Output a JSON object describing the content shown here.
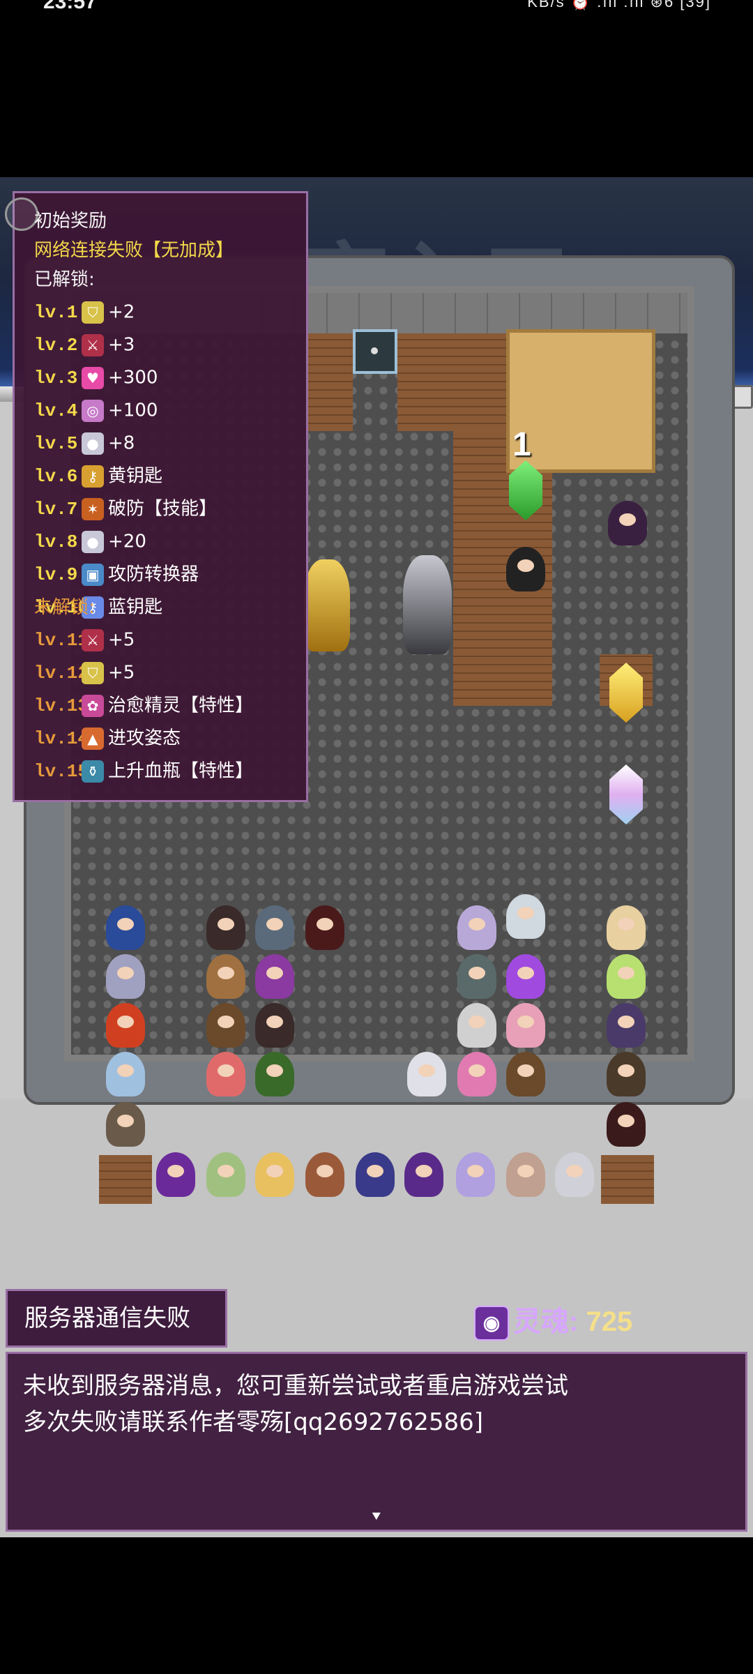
{
  "status_bar": {
    "time": "23:57",
    "right": "KB/s ⏰ .ıll .ıll ⊛6 [39]"
  },
  "banner": {
    "ghost_text": "牢入口"
  },
  "board": {
    "room_number": "1"
  },
  "info_panel": {
    "title": "初始奖励",
    "network_status": "网络连接失败【无加成】",
    "unlocked_header": "已解锁:",
    "locked_header": "未解锁:",
    "unlocked": [
      {
        "level": "lv.1",
        "icon": "shield-icon",
        "color": "#d8c24a",
        "reward": "+2"
      },
      {
        "level": "lv.2",
        "icon": "sword-icon",
        "color": "#b0304a",
        "reward": "+3"
      },
      {
        "level": "lv.3",
        "icon": "heart-icon",
        "color": "#e84aa8",
        "reward": "+300"
      },
      {
        "level": "lv.4",
        "icon": "magic-icon",
        "color": "#c67ac8",
        "reward": "+100"
      },
      {
        "level": "lv.5",
        "icon": "orb-icon",
        "color": "#c8c8d8",
        "reward": "+8"
      },
      {
        "level": "lv.6",
        "icon": "yellow-key-icon",
        "color": "#d8a030",
        "reward": "黄钥匙"
      },
      {
        "level": "lv.7",
        "icon": "claw-icon",
        "color": "#c86020",
        "reward": "破防【技能】"
      },
      {
        "level": "lv.8",
        "icon": "orb-icon",
        "color": "#c8c8d8",
        "reward": "+20"
      },
      {
        "level": "lv.9",
        "icon": "computer-icon",
        "color": "#4a8ac8",
        "reward": "攻防转换器"
      },
      {
        "level": "lv.10",
        "icon": "blue-key-icon",
        "color": "#6a8ae8",
        "reward": "蓝钥匙"
      }
    ],
    "locked": [
      {
        "level": "lv.11",
        "icon": "sword-icon",
        "color": "#b0304a",
        "reward": "+5"
      },
      {
        "level": "lv.12",
        "icon": "shield-icon",
        "color": "#d8c24a",
        "reward": "+5"
      },
      {
        "level": "lv.13",
        "icon": "fairy-icon",
        "color": "#c84a98",
        "reward": "治愈精灵【特性】"
      },
      {
        "level": "lv.14",
        "icon": "atk-icon",
        "color": "#d86a30",
        "reward": "进攻姿态"
      },
      {
        "level": "lv.15",
        "icon": "potion-icon",
        "color": "#3a8aa8",
        "reward": "上升血瓶【特性】"
      }
    ]
  },
  "server_error": {
    "title": "服务器通信失败",
    "message_line1": "未收到服务器消息，您可重新尝试或者重启游戏尝试",
    "message_line2": "多次失败请联系作者零殇[qq2692762586]",
    "continue_arrow": "⯆"
  },
  "soul": {
    "label": "灵魂:",
    "value": "725"
  }
}
